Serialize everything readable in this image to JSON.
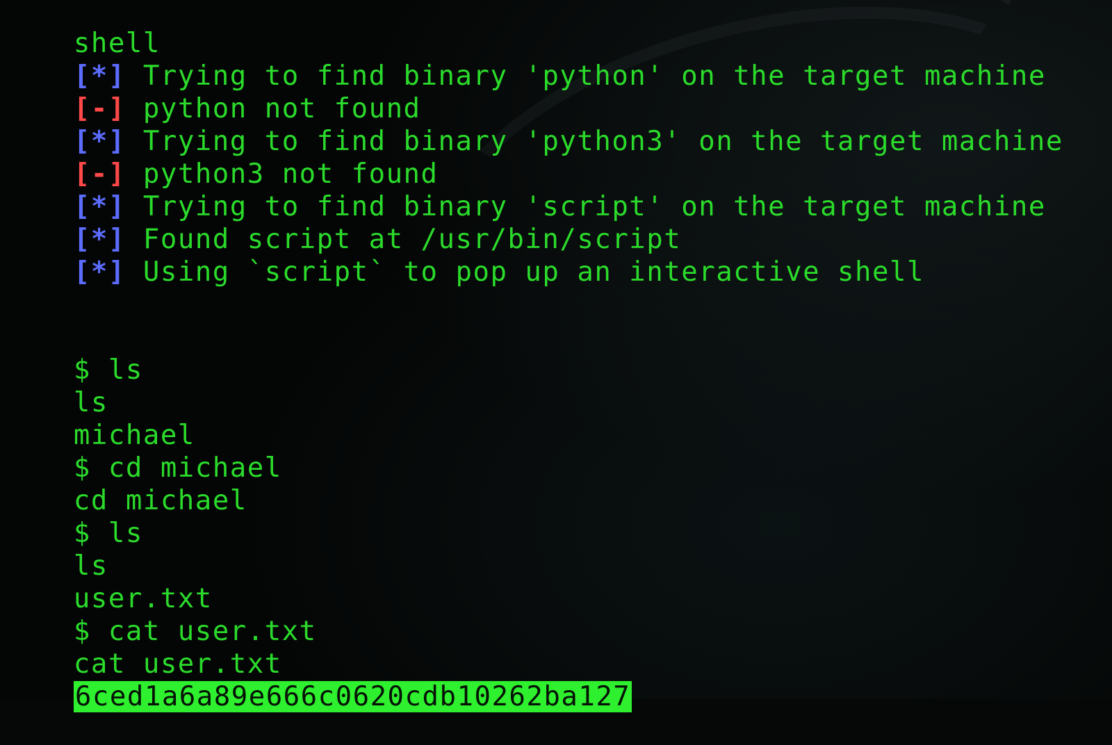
{
  "terminal": {
    "colors": {
      "background": "#040605",
      "text": "#2bdb2b",
      "info_tag": "#5c6cff",
      "error_tag": "#ff4848",
      "highlight_bg": "#2ef02e"
    },
    "lines": [
      {
        "text": "shell"
      },
      {
        "tag": "[*]",
        "text": " Trying to find binary 'python' on the target machine"
      },
      {
        "tag": "[-]",
        "text": " python not found"
      },
      {
        "tag": "[*]",
        "text": " Trying to find binary 'python3' on the target machine"
      },
      {
        "tag": "[-]",
        "text": " python3 not found"
      },
      {
        "tag": "[*]",
        "text": " Trying to find binary 'script' on the target machine"
      },
      {
        "tag": "[*]",
        "text": " Found script at /usr/bin/script"
      },
      {
        "tag": "[*]",
        "text": " Using `script` to pop up an interactive shell"
      },
      {
        "text": "$ ls"
      },
      {
        "text": "ls"
      },
      {
        "text": "michael"
      },
      {
        "text": "$ cd michael"
      },
      {
        "text": "cd michael"
      },
      {
        "text": "$ ls"
      },
      {
        "text": "ls"
      },
      {
        "text": "user.txt"
      },
      {
        "text": "$ cat user.txt"
      },
      {
        "text": "cat user.txt"
      },
      {
        "text": "6ced1a6a89e666c0620cdb10262ba127"
      }
    ]
  }
}
